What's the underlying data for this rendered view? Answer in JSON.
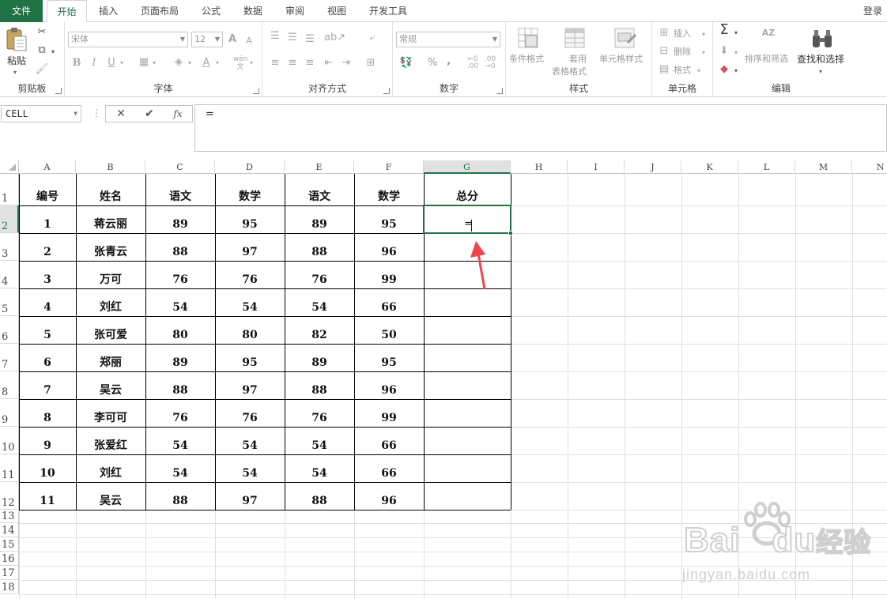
{
  "ribbon_tabs": {
    "file": "文件",
    "home": "开始",
    "insert": "插入",
    "page_layout": "页面布局",
    "formulas": "公式",
    "data": "数据",
    "review": "审阅",
    "view": "视图",
    "developer": "开发工具",
    "login": "登录"
  },
  "ribbon": {
    "clipboard": {
      "label": "剪贴板",
      "paste": "粘贴"
    },
    "font": {
      "label": "字体",
      "font_name": "宋体",
      "font_size": "12",
      "bold": "B",
      "italic": "I",
      "underline": "U",
      "font_grow": "A",
      "font_shrink": "A",
      "font_color": "A"
    },
    "alignment": {
      "label": "对齐方式"
    },
    "number": {
      "label": "数字",
      "format": "常规",
      "percent": "%",
      "comma": ","
    },
    "styles": {
      "label": "样式",
      "conditional": "条件格式",
      "as_table_1": "套用",
      "as_table_2": "表格格式",
      "cell_styles": "单元格样式"
    },
    "cells": {
      "label": "单元格",
      "insert": "插入",
      "delete": "删除",
      "format": "格式"
    },
    "editing": {
      "label": "编辑",
      "sort_filter": "排序和筛选",
      "find_select": "查找和选择",
      "sigma": "Σ",
      "sort_az": "AZ"
    }
  },
  "formula_bar": {
    "name_box": "CELL",
    "cancel": "✕",
    "enter": "✔",
    "fx": "fx",
    "content": "="
  },
  "columns": [
    "A",
    "B",
    "C",
    "D",
    "E",
    "F",
    "G",
    "H",
    "I",
    "J",
    "K",
    "L",
    "M",
    "N"
  ],
  "rows": [
    "1",
    "2",
    "3",
    "4",
    "5",
    "6",
    "7",
    "8",
    "9",
    "10",
    "11",
    "12",
    "13",
    "14",
    "15",
    "16",
    "17",
    "18"
  ],
  "table": {
    "headers": [
      "编号",
      "姓名",
      "语文",
      "数学",
      "语文",
      "数学",
      "总分"
    ],
    "rows": [
      [
        "1",
        "蒋云丽",
        "89",
        "95",
        "89",
        "95"
      ],
      [
        "2",
        "张青云",
        "88",
        "97",
        "88",
        "96"
      ],
      [
        "3",
        "万可",
        "76",
        "76",
        "76",
        "99"
      ],
      [
        "4",
        "刘红",
        "54",
        "54",
        "54",
        "66"
      ],
      [
        "5",
        "张可爱",
        "80",
        "80",
        "82",
        "50"
      ],
      [
        "6",
        "郑丽",
        "89",
        "95",
        "89",
        "95"
      ],
      [
        "7",
        "吴云",
        "88",
        "97",
        "88",
        "96"
      ],
      [
        "8",
        "李可可",
        "76",
        "76",
        "76",
        "99"
      ],
      [
        "9",
        "张爱红",
        "54",
        "54",
        "54",
        "66"
      ],
      [
        "10",
        "刘红",
        "54",
        "54",
        "54",
        "66"
      ],
      [
        "11",
        "吴云",
        "88",
        "97",
        "88",
        "96"
      ]
    ]
  },
  "active_cell": {
    "ref": "G2",
    "edit_text": "="
  },
  "colors": {
    "accent": "#217346",
    "arrow": "#f0464a"
  },
  "watermark": {
    "brand": "Bai",
    "brand2": "du",
    "cn": "经验",
    "url": "jingyan.baidu.com"
  }
}
